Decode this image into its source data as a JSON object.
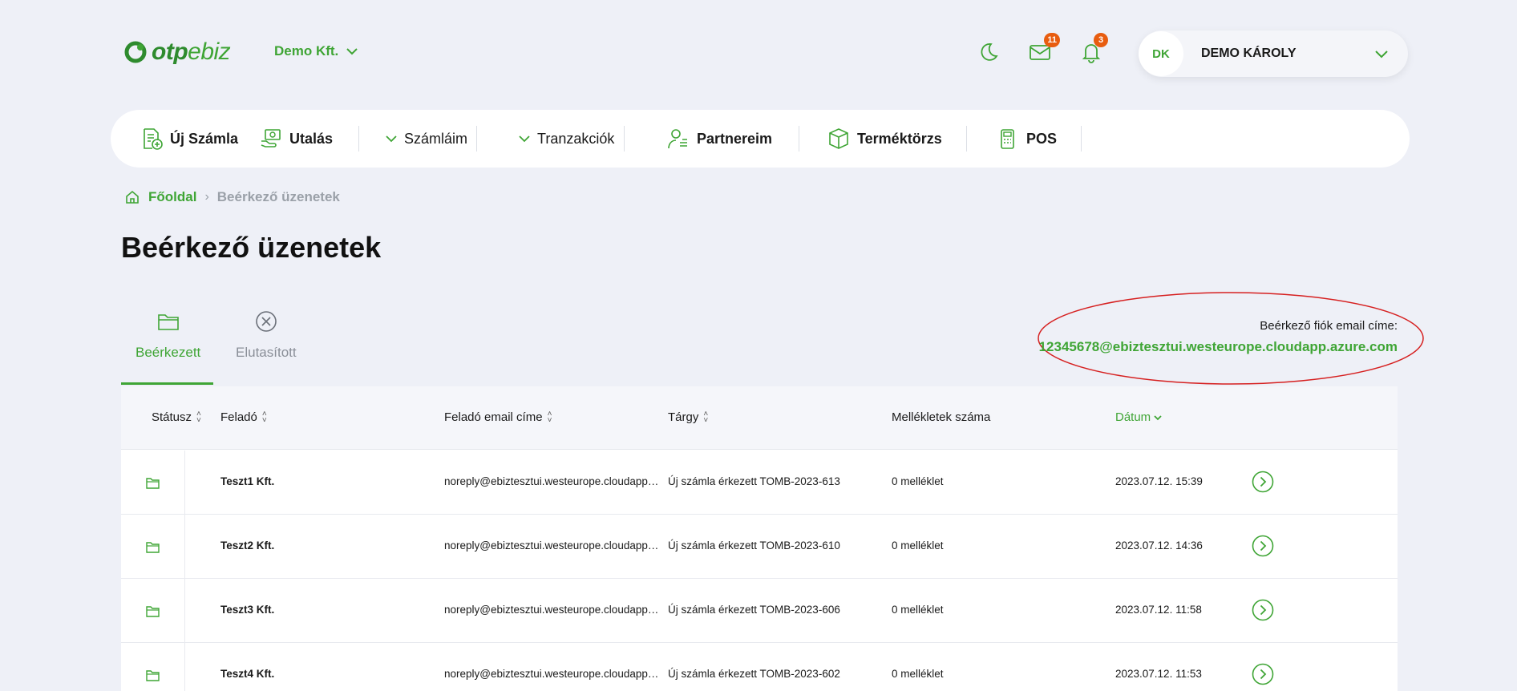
{
  "header": {
    "logo_bold": "otp",
    "logo_light": "ebiz",
    "company": "Demo Kft.",
    "messages_badge": "11",
    "notifications_badge": "3",
    "user_initials": "DK",
    "user_name": "DEMO KÁROLY"
  },
  "nav": {
    "items": [
      {
        "label": "Új Számla",
        "icon": "new-invoice-icon"
      },
      {
        "label": "Utalás",
        "icon": "transfer-icon"
      },
      {
        "label": "Számláim",
        "icon": "chevron-down-icon"
      },
      {
        "label": "Tranzakciók",
        "icon": "chevron-down-icon"
      },
      {
        "label": "Partnereim",
        "icon": "partners-icon"
      },
      {
        "label": "Terméktörzs",
        "icon": "box-icon"
      },
      {
        "label": "POS",
        "icon": "pos-terminal-icon"
      }
    ]
  },
  "breadcrumb": {
    "home": "Főoldal",
    "current": "Beérkező üzenetek"
  },
  "page_title": "Beérkező üzenetek",
  "tabs": [
    {
      "label": "Beérkezett",
      "icon": "folder-icon",
      "active": true
    },
    {
      "label": "Elutasított",
      "icon": "reject-circle-icon",
      "active": false
    }
  ],
  "inbox_email": {
    "label": "Beérkező fiók email címe:",
    "value": "12345678@ebiztesztui.westeurope.cloudapp.azure.com"
  },
  "table": {
    "columns": [
      "Státusz",
      "Feladó",
      "Feladó email címe",
      "Tárgy",
      "Mellékletek száma",
      "Dátum"
    ],
    "rows": [
      {
        "sender": "Teszt1 Kft.",
        "email": "noreply@ebiztesztui.westeurope.cloudapp.azure.com",
        "subject": "Új számla érkezett TOMB-2023-613",
        "attachments": "0 melléklet",
        "date": "2023.07.12. 15:39"
      },
      {
        "sender": "Teszt2 Kft.",
        "email": "noreply@ebiztesztui.westeurope.cloudapp.azure.com",
        "subject": "Új számla érkezett TOMB-2023-610",
        "attachments": "0 melléklet",
        "date": "2023.07.12. 14:36"
      },
      {
        "sender": "Teszt3 Kft.",
        "email": "noreply@ebiztesztui.westeurope.cloudapp.azure.com",
        "subject": "Új számla érkezett TOMB-2023-606",
        "attachments": "0 melléklet",
        "date": "2023.07.12. 11:58"
      },
      {
        "sender": "Teszt4 Kft.",
        "email": "noreply@ebiztesztui.westeurope.cloudapp.azure.com",
        "subject": "Új számla érkezett TOMB-2023-602",
        "attachments": "0 melléklet",
        "date": "2023.07.12. 11:53"
      }
    ]
  },
  "colors": {
    "brand_green": "#3fa535",
    "badge_orange": "#e85d10",
    "highlight_ellipse": "#d62020"
  }
}
